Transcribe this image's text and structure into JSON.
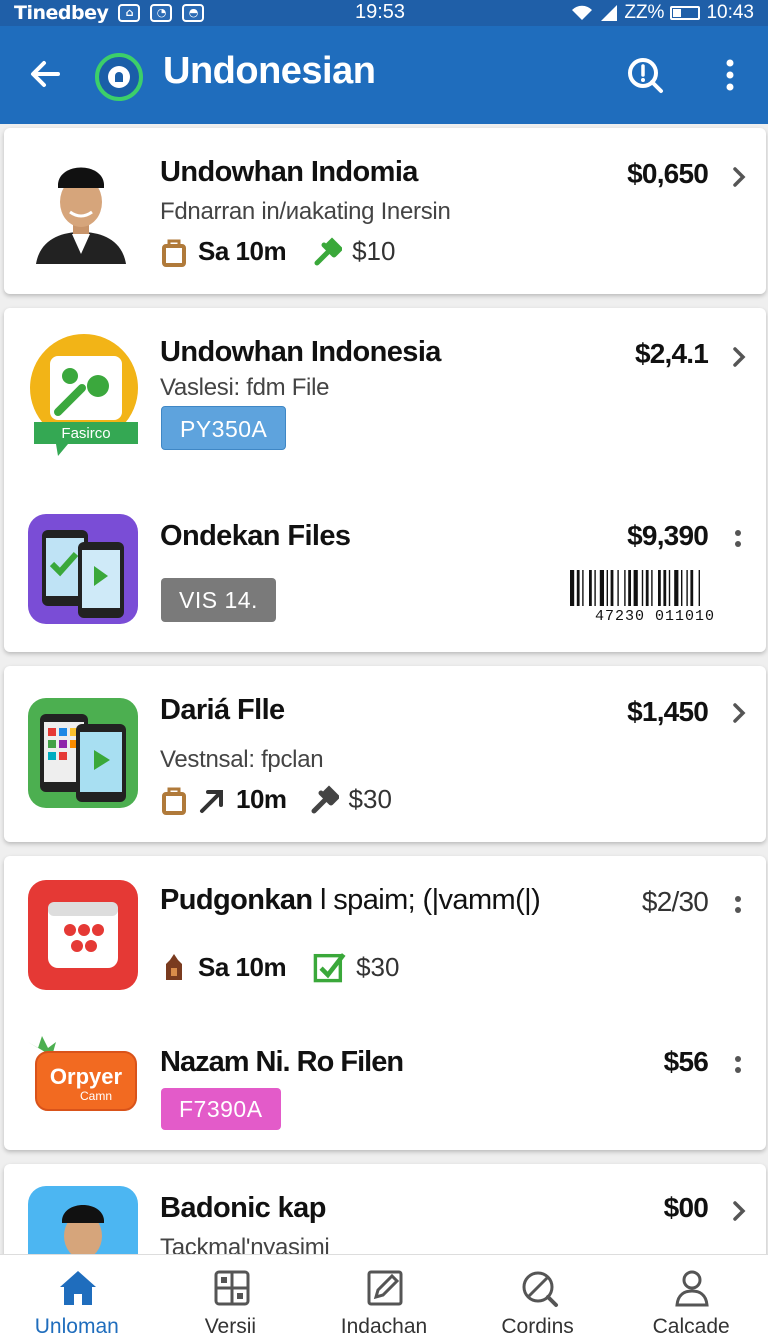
{
  "status_bar": {
    "carrier": "Tinedbey",
    "time": "19:53",
    "battery_text": "ZZ%",
    "clock_right": "10:43"
  },
  "app_bar": {
    "title": "Undonesian",
    "back_icon": "arrow-left-icon",
    "search_icon": "search-icon",
    "more_icon": "more-vert-icon"
  },
  "colors": {
    "primary": "#1f6dbd",
    "status": "#1f5fa8",
    "accent_green": "#3ccf6a"
  },
  "list": {
    "item1": {
      "name": "Undowhan Indomia",
      "subtitle": "Fdnarran in/иakating Inersin",
      "price": "$0,650",
      "meta1": "Sa 10m",
      "meta2": "$10"
    },
    "item2": {
      "name": "Undowhan Indonesia",
      "subtitle": "Vaslesi: fdm File",
      "price": "$2,4.1",
      "tag": "PY350A",
      "thumb_label": "Fasirco"
    },
    "item3": {
      "name": "Ondekan Files",
      "price": "$9,390",
      "tag": "VIS 14.",
      "barcode_number": "47230 011010"
    },
    "item4": {
      "name": "Dariá Flle",
      "subtitle": "Vestnsal: fpclan",
      "price": "$1,450",
      "meta1": "10m",
      "meta2": "$30"
    },
    "item5": {
      "name": "Pudgonkan",
      "name_extra": "l spaim; (|vamm(|)",
      "price": "$2/30",
      "meta1": "Sa 10m",
      "meta2": "$30"
    },
    "item6": {
      "name": "Nazam Ni. Ro Filen",
      "price": "$56",
      "tag": "F7390A",
      "thumb_label": "Orpyer",
      "thumb_sublabel": "Camn"
    },
    "item7": {
      "name": "Badonic kap",
      "subtitle": "Tackmal'nyasimi",
      "price": "$00"
    }
  },
  "bottom_nav": [
    {
      "label": "Unloman",
      "icon": "home-icon",
      "active": true
    },
    {
      "label": "Versii",
      "icon": "grid-icon",
      "active": false
    },
    {
      "label": "Indachan",
      "icon": "edit-icon",
      "active": false
    },
    {
      "label": "Cordins",
      "icon": "block-search-icon",
      "active": false
    },
    {
      "label": "Calcade",
      "icon": "person-icon",
      "active": false
    }
  ]
}
